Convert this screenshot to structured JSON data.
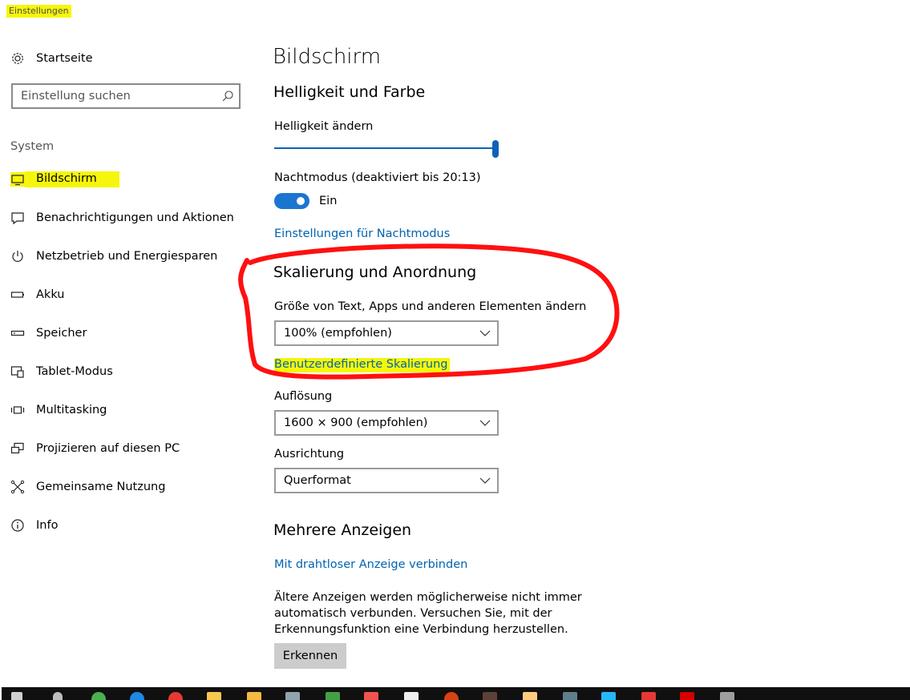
{
  "app": {
    "title": "Einstellungen"
  },
  "sidebar": {
    "home_label": "Startseite",
    "search_placeholder": "Einstellung suchen",
    "group_label": "System",
    "items": [
      {
        "label": "Bildschirm",
        "icon": "monitor-icon",
        "selected": true
      },
      {
        "label": "Benachrichtigungen und Aktionen",
        "icon": "notification-icon"
      },
      {
        "label": "Netzbetrieb und Energiesparen",
        "icon": "power-icon"
      },
      {
        "label": "Akku",
        "icon": "battery-icon"
      },
      {
        "label": "Speicher",
        "icon": "storage-icon"
      },
      {
        "label": "Tablet-Modus",
        "icon": "tablet-mode-icon"
      },
      {
        "label": "Multitasking",
        "icon": "multitasking-icon"
      },
      {
        "label": "Projizieren auf diesen PC",
        "icon": "project-icon"
      },
      {
        "label": "Gemeinsame Nutzung",
        "icon": "share-icon"
      },
      {
        "label": "Info",
        "icon": "info-icon"
      }
    ]
  },
  "main": {
    "title": "Bildschirm",
    "brightness_section": {
      "heading": "Helligkeit und Farbe",
      "brightness_label": "Helligkeit ändern",
      "brightness_value": 1.0,
      "night_mode_label": "Nachtmodus (deaktiviert bis 20:13)",
      "night_mode_toggle": "Ein",
      "night_mode_link": "Einstellungen für Nachtmodus"
    },
    "scale_section": {
      "heading": "Skalierung und Anordnung",
      "scale_label": "Größe von Text, Apps und anderen Elementen ändern",
      "scale_value": "100% (empfohlen)",
      "custom_scale_link": "Benutzerdefinierte Skalierung",
      "resolution_label": "Auflösung",
      "resolution_value": "1600 × 900 (empfohlen)",
      "orientation_label": "Ausrichtung",
      "orientation_value": "Querformat"
    },
    "multi_display": {
      "heading": "Mehrere Anzeigen",
      "wireless_link": "Mit drahtloser Anzeige verbinden",
      "description": "Ältere Anzeigen werden möglicherweise nicht immer automatisch verbunden. Versuchen Sie, mit der Erkennungsfunktion eine Verbindung herzustellen.",
      "detect_button": "Erkennen"
    }
  },
  "colors": {
    "accent": "#0063b1",
    "highlight": "#f6f60a",
    "annotation": "#ff0000",
    "taskbar": "#101010"
  },
  "taskbar": {
    "icons": [
      "start-icon",
      "search-icon",
      "chrome-icon",
      "edge-icon",
      "opera-icon",
      "explorer-icon",
      "folder-icon",
      "app-icon",
      "spreadsheet-icon",
      "pdf-icon",
      "calendar-icon",
      "media-icon",
      "app-icon",
      "game-icon",
      "app-icon",
      "app-icon",
      "app-icon",
      "app-icon",
      "app-icon"
    ]
  }
}
